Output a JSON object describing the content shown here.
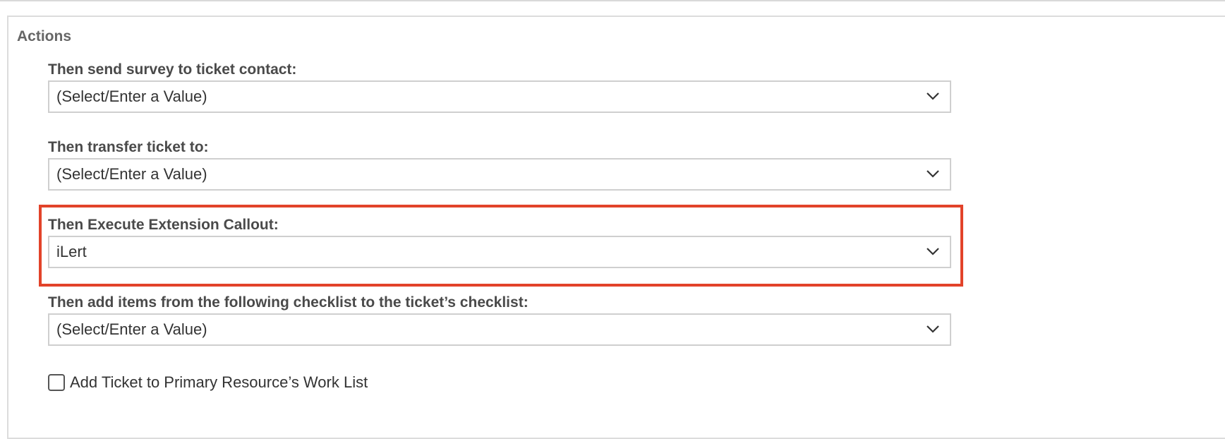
{
  "section": {
    "title": "Actions"
  },
  "fields": [
    {
      "label": "Then send survey to ticket contact:",
      "value": "(Select/Enter a Value)"
    },
    {
      "label": "Then transfer ticket to:",
      "value": "(Select/Enter a Value)"
    },
    {
      "label": "Then Execute Extension Callout:",
      "value": "iLert"
    },
    {
      "label": "Then add items from the following checklist to the ticket’s checklist:",
      "value": "(Select/Enter a Value)"
    }
  ],
  "checkbox": {
    "label": "Add Ticket to Primary Resource’s Work List",
    "checked": false
  },
  "icons": {
    "dropdown": "chevron-down-icon"
  },
  "colors": {
    "highlight": "#e2432a",
    "border": "#cfcfcf",
    "section_title": "#666666"
  }
}
